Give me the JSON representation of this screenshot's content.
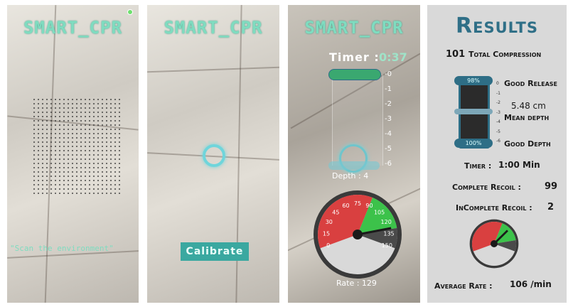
{
  "app_title": "SMART_CPR",
  "panel1": {
    "instruction": "\"Scan the environment\""
  },
  "panel2": {
    "calibrate_label": "Calibrate"
  },
  "panel3": {
    "timer_label": "Timer :",
    "timer_value": "0:37",
    "depth_ticks": [
      "-0",
      "-1",
      "-2",
      "-3",
      "-4",
      "-5",
      "-6"
    ],
    "depth_label": "Depth : 4",
    "rate_label": "Rate : 129",
    "gauge_ticks": [
      "0",
      "15",
      "30",
      "45",
      "60",
      "75",
      "90",
      "105",
      "120",
      "135",
      "150"
    ],
    "rate_value": 129
  },
  "results": {
    "title": "Results",
    "total_compression_value": "101",
    "total_compression_label": "Total Compression",
    "good_release_pct": "98%",
    "good_release_label": "Good Release",
    "depth_ticks": [
      "0",
      "-1",
      "-2",
      "-3",
      "-4",
      "-5",
      "-6"
    ],
    "mean_depth_value": "5.48 cm",
    "mean_depth_label": "Mean depth",
    "good_depth_pct": "100%",
    "good_depth_label": "Good Depth",
    "timer_label": "Timer :",
    "timer_value": "1:00 Min",
    "complete_recoil_label": "Complete Recoil :",
    "complete_recoil_value": "99",
    "incomplete_recoil_label": "InComplete Recoil :",
    "incomplete_recoil_value": "2",
    "average_rate_label": "Average Rate :",
    "average_rate_value": "106 /min",
    "average_rate": 106
  },
  "colors": {
    "accent": "#7fdcc0",
    "results_title": "#2f6f87",
    "gauge_red": "#d94040",
    "gauge_green": "#3cc24a"
  }
}
